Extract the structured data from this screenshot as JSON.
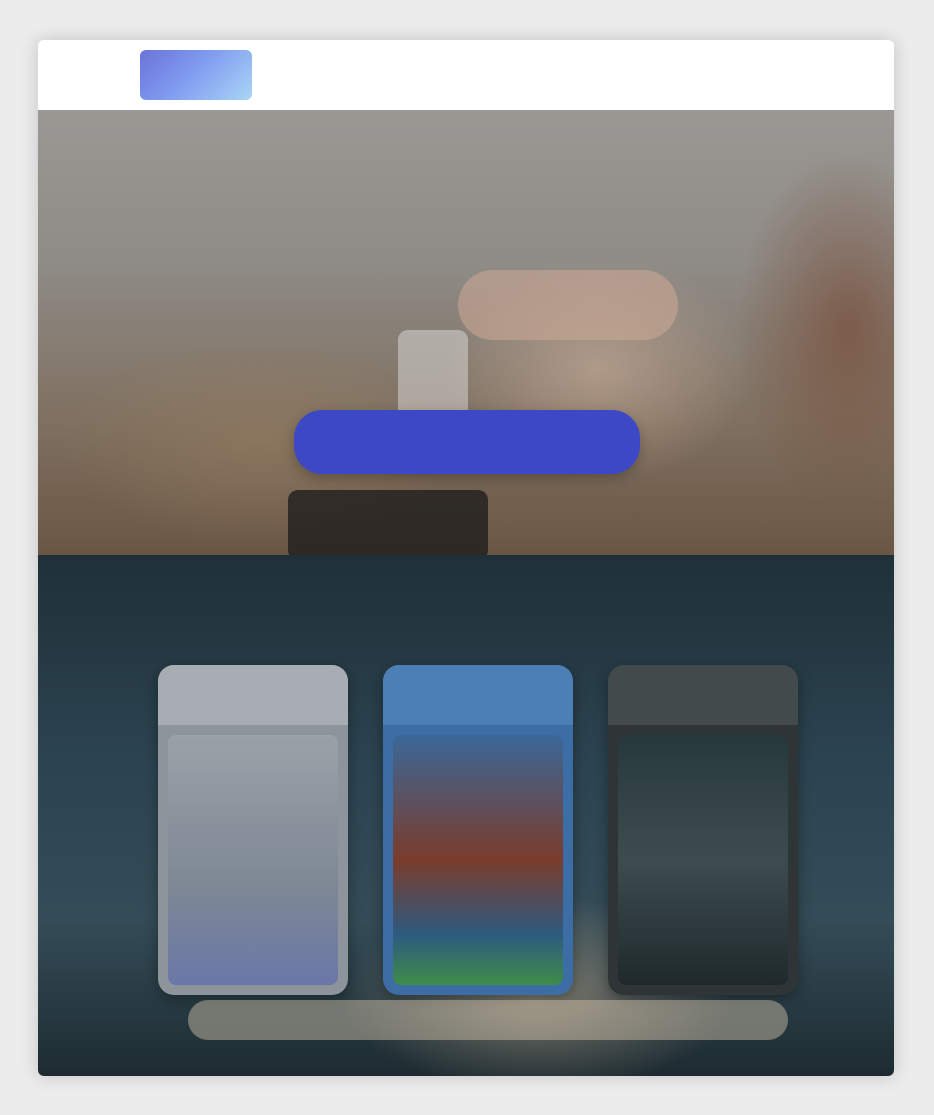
{
  "header": {
    "logo_text": "",
    "nav": [
      "",
      ""
    ]
  },
  "hero": {
    "title": "",
    "cta_label": ""
  },
  "products": {
    "title": "",
    "subtitle": "",
    "items": [
      {
        "name": ""
      },
      {
        "name": ""
      },
      {
        "name": ""
      }
    ]
  },
  "colors": {
    "accent": "#3d49c4",
    "logo_gradient_start": "#6b73d8",
    "logo_gradient_end": "#a9d6f5",
    "section_dark": "#2c4451"
  }
}
